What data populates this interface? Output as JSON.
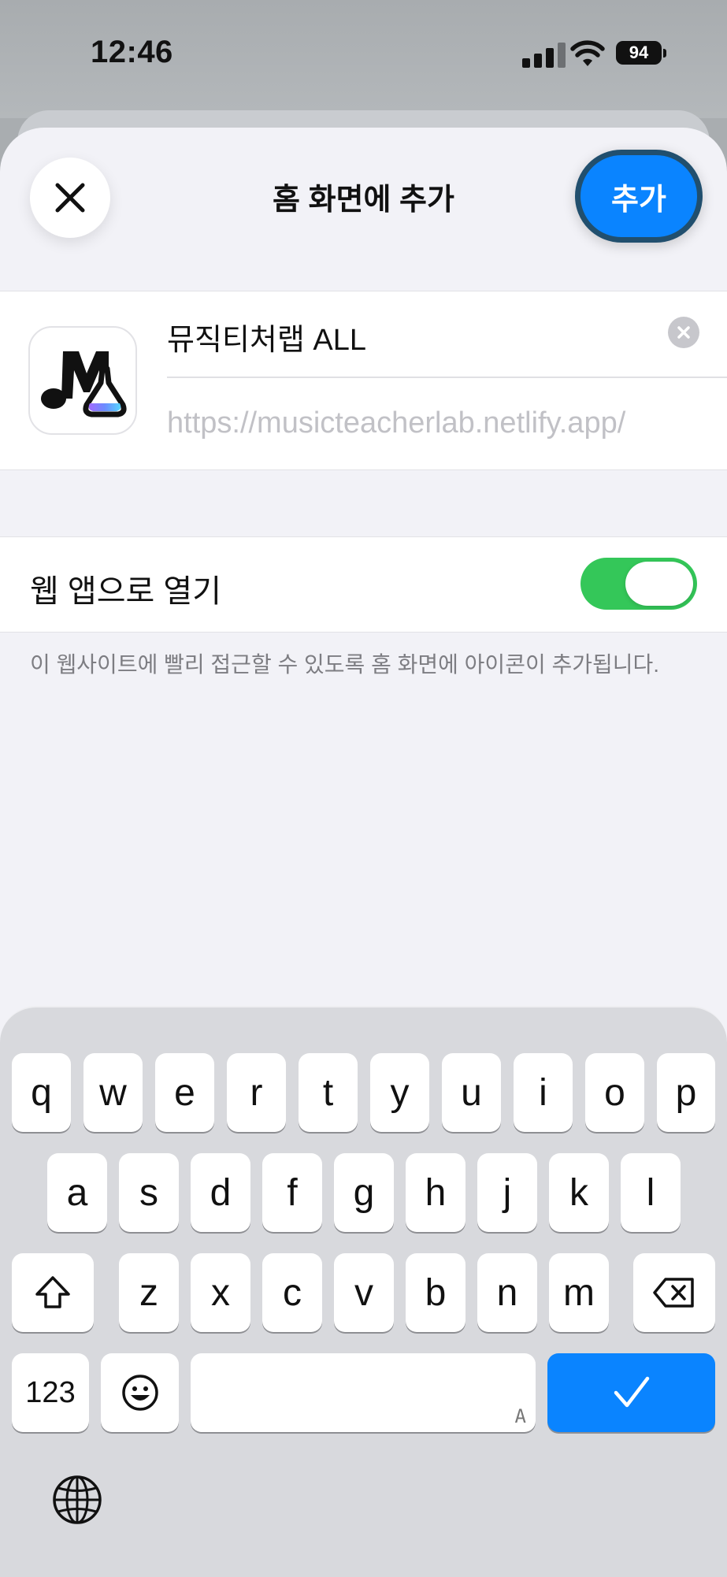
{
  "status_bar": {
    "time": "12:46",
    "battery": "94"
  },
  "header": {
    "title": "홈 화면에 추가",
    "add_label": "추가"
  },
  "bookmark": {
    "name": "뮤직티처랩 ALL",
    "url": "https://musicteacherlab.netlify.app/"
  },
  "web_app": {
    "label": "웹 앱으로 열기",
    "enabled": true
  },
  "footnote": "이 웹사이트에 빨리 접근할 수 있도록 홈 화면에 아이콘이 추가됩니다.",
  "keyboard": {
    "row1": [
      "q",
      "w",
      "e",
      "r",
      "t",
      "y",
      "u",
      "i",
      "o",
      "p"
    ],
    "row2": [
      "a",
      "s",
      "d",
      "f",
      "g",
      "h",
      "j",
      "k",
      "l"
    ],
    "row3": [
      "z",
      "x",
      "c",
      "v",
      "b",
      "n",
      "m"
    ],
    "numbers_label": "123",
    "space_hint": "A"
  },
  "colors": {
    "accent": "#0a84ff",
    "toggle_on": "#34c759"
  },
  "icons": [
    "close-icon",
    "clear-icon",
    "shift-icon",
    "delete-icon",
    "emoji-icon",
    "checkmark-icon",
    "globe-icon",
    "signal-icon",
    "wifi-icon",
    "battery-icon"
  ]
}
